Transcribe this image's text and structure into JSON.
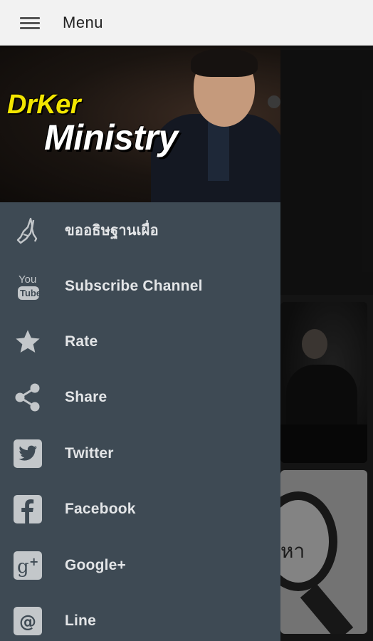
{
  "appbar": {
    "title": "Menu",
    "menu_icon": "hamburger-menu-icon"
  },
  "drawer": {
    "header": {
      "brand_line1": "DrKer",
      "brand_line2": "Ministry"
    },
    "items": [
      {
        "label": "ขออธิษฐานเผื่อ",
        "icon": "praying-hands-icon"
      },
      {
        "label": "Subscribe Channel",
        "icon": "youtube-icon"
      },
      {
        "label": "Rate",
        "icon": "star-icon"
      },
      {
        "label": "Share",
        "icon": "share-icon"
      },
      {
        "label": "Twitter",
        "icon": "twitter-icon"
      },
      {
        "label": "Facebook",
        "icon": "facebook-icon"
      },
      {
        "label": "Google+",
        "icon": "google-plus-icon"
      },
      {
        "label": "Line",
        "icon": "line-at-icon"
      }
    ]
  },
  "background_content": {
    "card2_glyph": "หา"
  },
  "colors": {
    "appbar_bg": "#f2f2f2",
    "drawer_bg": "#3e4a54",
    "menu_text": "#e3e5e7",
    "icon_gray": "#c3c7ca",
    "brand_yellow": "#f2e500"
  }
}
